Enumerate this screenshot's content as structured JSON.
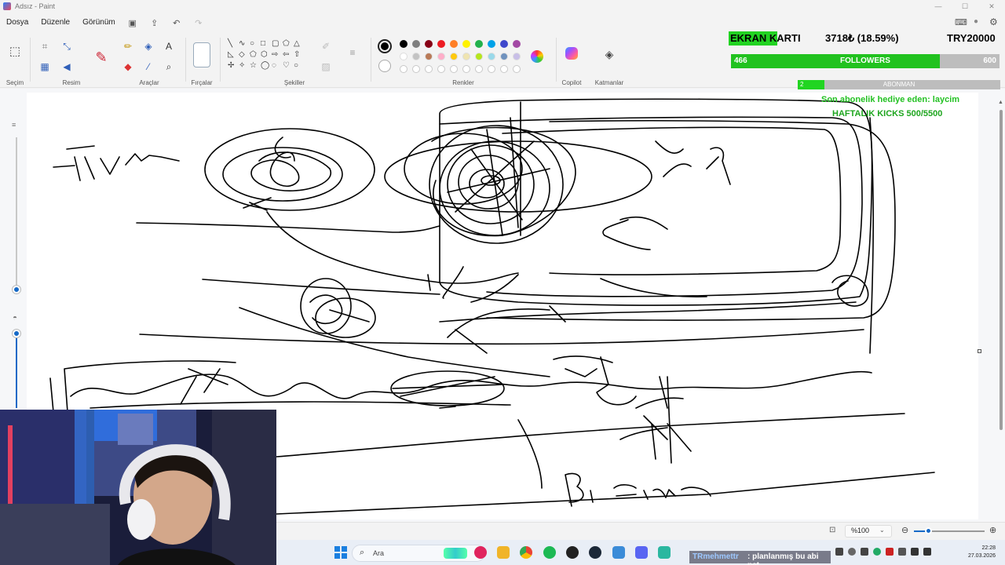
{
  "window": {
    "title": "Adsız - Paint"
  },
  "menu": {
    "file": "Dosya",
    "edit": "Düzenle",
    "view": "Görünüm"
  },
  "ribbon": {
    "groups": {
      "selection": "Seçim",
      "image": "Resim",
      "tools": "Araçlar",
      "brushes": "Fırçalar",
      "shapes": "Şekiller",
      "colors": "Renkler",
      "copilot": "Copilot",
      "layers": "Katmanlar"
    },
    "primary_color": "#000000",
    "palette_row1": [
      "#000000",
      "#7f7f7f",
      "#880015",
      "#ed1c24",
      "#ff7f27",
      "#fff200",
      "#22b14c",
      "#00a2e8",
      "#3f48cc",
      "#a349a4"
    ],
    "palette_row2": [
      "#ffffff",
      "#c3c3c3",
      "#b97a57",
      "#ffaec9",
      "#ffc90e",
      "#efe4b0",
      "#b5e61d",
      "#99d9ea",
      "#7092be",
      "#c8bfe7"
    ]
  },
  "overlay": {
    "ekran_label": "EKRAN KARTI",
    "money": "3718₺ (18.59%)",
    "target": "TRY20000",
    "followers": {
      "current": "466",
      "label": "FOLLOWERS",
      "goal": "600",
      "progress": 0.777
    },
    "abonman": {
      "current": "2",
      "label": "ABONMAN",
      "progress": 0.13
    },
    "last_gift": "Son abonelik hediye eden: laycim",
    "weekly_kicks": "HAFTALIK KICKS 500/5500"
  },
  "status": {
    "zoom": "%100",
    "zoom_progress": 0.2
  },
  "taskbar": {
    "search_placeholder": "Ara",
    "chat_user": "TRmehmettr",
    "chat_message": ": planlanmış bu abi net",
    "time": "22:28",
    "date": "27.03.2026"
  },
  "icons": {
    "select": "select-icon",
    "crop": "crop-icon",
    "pencil": "pencil-icon",
    "fill": "fill-icon",
    "text": "text-icon",
    "eraser": "eraser-icon",
    "picker": "color-picker-icon",
    "magnifier": "magnifier-icon",
    "brush": "brush-icon",
    "copilot": "copilot-icon",
    "layers": "layers-icon"
  }
}
